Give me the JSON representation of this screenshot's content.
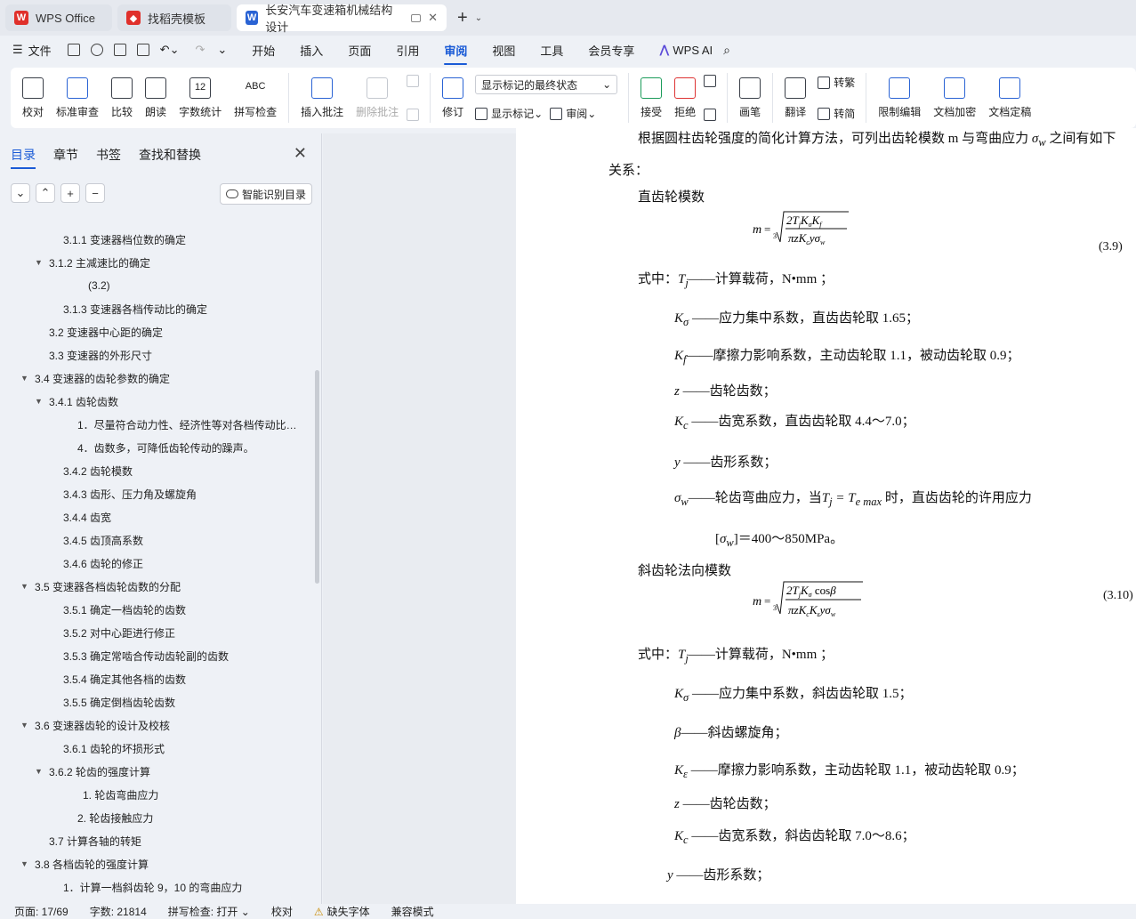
{
  "tabs": [
    {
      "label": "WPS Office",
      "color": "#e0302b"
    },
    {
      "label": "找稻壳模板",
      "color": "#e0302b"
    },
    {
      "label": "长安汽车变速箱机械结构设计",
      "color": "#2a63d4"
    }
  ],
  "menu": {
    "file": "文件",
    "items": [
      "开始",
      "插入",
      "页面",
      "引用",
      "审阅",
      "视图",
      "工具",
      "会员专享"
    ],
    "active": "审阅",
    "ai": "WPS AI"
  },
  "ribbon": {
    "proofread": "校对",
    "standard_review": "标准审查",
    "compare": "比较",
    "read_aloud": "朗读",
    "word_count": "字数统计",
    "spell_check": "拼写检查",
    "insert_comment": "插入批注",
    "delete_comment": "删除批注",
    "revise": "修订",
    "display_state": "显示标记的最终状态",
    "show_markup": "显示标记",
    "review": "审阅",
    "accept": "接受",
    "reject": "拒绝",
    "pen": "画笔",
    "translate": "翻译",
    "to_traditional": "转繁",
    "to_simplified": "转简",
    "restrict_edit": "限制编辑",
    "encrypt": "文档加密",
    "finalize": "文档定稿",
    "icon_word_count": "12",
    "icon_spell": "ABC"
  },
  "nav": {
    "tabs": [
      "目录",
      "章节",
      "书签",
      "查找和替换"
    ],
    "smart_toc": "智能识别目录",
    "items": [
      {
        "text": "3.1.1 变速器档位数的确定",
        "indent": 71,
        "caret": ""
      },
      {
        "text": "3.1.2 主减速比的确定",
        "indent": 55,
        "caret": "▼"
      },
      {
        "text": "(3.2)",
        "indent": 99,
        "caret": ""
      },
      {
        "text": "3.1.3  变速器各档传动比的确定",
        "indent": 71,
        "caret": ""
      },
      {
        "text": "3.2 变速器中心距的确定",
        "indent": 55,
        "caret": ""
      },
      {
        "text": "3.3 变速器的外形尺寸",
        "indent": 55,
        "caret": ""
      },
      {
        "text": "3.4 变速器的齿轮参数的确定",
        "indent": 39,
        "caret": "▼"
      },
      {
        "text": "3.4.1 齿轮齿数",
        "indent": 55,
        "caret": "▼"
      },
      {
        "text": "1．尽量符合动力性、经济性等对各档传动比…",
        "indent": 87,
        "caret": ""
      },
      {
        "text": "4．齿数多，可降低齿轮传动的躁声。",
        "indent": 87,
        "caret": ""
      },
      {
        "text": "3.4.2 齿轮模数",
        "indent": 71,
        "caret": ""
      },
      {
        "text": "3.4.3 齿形、压力角及螺旋角",
        "indent": 71,
        "caret": ""
      },
      {
        "text": "3.4.4 齿宽",
        "indent": 71,
        "caret": ""
      },
      {
        "text": "3.4.5 齿顶高系数",
        "indent": 71,
        "caret": ""
      },
      {
        "text": "3.4.6 齿轮的修正",
        "indent": 71,
        "caret": ""
      },
      {
        "text": "3.5 变速器各档齿轮齿数的分配",
        "indent": 39,
        "caret": "▼"
      },
      {
        "text": "3.5.1 确定一档齿轮的齿数",
        "indent": 71,
        "caret": ""
      },
      {
        "text": "3.5.2 对中心距进行修正",
        "indent": 71,
        "caret": ""
      },
      {
        "text": "3.5.3 确定常啮合传动齿轮副的齿数",
        "indent": 71,
        "caret": ""
      },
      {
        "text": "3.5.4 确定其他各档的齿数",
        "indent": 71,
        "caret": ""
      },
      {
        "text": "3.5.5 确定倒档齿轮齿数",
        "indent": 71,
        "caret": ""
      },
      {
        "text": "3.6 变速器齿轮的设计及校核",
        "indent": 39,
        "caret": "▼"
      },
      {
        "text": "3.6.1  齿轮的坏损形式",
        "indent": 71,
        "caret": ""
      },
      {
        "text": "3.6.2 轮齿的强度计算",
        "indent": 55,
        "caret": "▼"
      },
      {
        "text": "1. 轮齿弯曲应力",
        "indent": 93,
        "caret": ""
      },
      {
        "text": "2. 轮齿接触应力",
        "indent": 87,
        "caret": ""
      },
      {
        "text": "3.7 计算各轴的转矩",
        "indent": 55,
        "caret": ""
      },
      {
        "text": "3.8 各档齿轮的强度计算",
        "indent": 39,
        "caret": "▼"
      },
      {
        "text": "1．计算一档斜齿轮 9，10 的弯曲应力",
        "indent": 71,
        "caret": ""
      }
    ]
  },
  "doc": {
    "l1": "根据圆柱齿轮强度的简化计算方法，可列出齿轮模数 m 与弯曲应力",
    "l1_tail": "之间有如下",
    "l2": "关系：",
    "spur_title": "直齿轮模数",
    "eq1_no": "(3.9)",
    "where": "式中：",
    "load": "——计算载荷，N•mm ；",
    "k_sigma": "——应力集中系数，直齿齿轮取 1.65；",
    "k_f": "——摩擦力影响系数，主动齿轮取 1.1，被动齿轮取 0.9；",
    "z": "——齿轮齿数；",
    "k_c": "——齿宽系数，直齿齿轮取 4.4～7.0；",
    "y": "——齿形系数；",
    "sigma_w": "——轮齿弯曲应力，当",
    "sigma_w_tail": "时，直齿齿轮的许用应力",
    "allow": "]＝400～850MPa。",
    "helical_title": "斜齿轮法向模数",
    "eq2_no": "(3.10)",
    "k_sigma2": "——应力集中系数，斜齿齿轮取 1.5；",
    "beta": "——斜齿螺旋角；",
    "k_e": "——摩擦力影响系数，主动齿轮取 1.1，被动齿轮取 0.9；",
    "k_c2": "——齿宽系数，斜齿齿轮取 7.0～8.6；",
    "y2": " ——齿形系数；"
  },
  "status": {
    "page": "页面: 17/69",
    "words": "字数: 21814",
    "spell": "拼写检查: 打开",
    "proof": "校对",
    "missing_font": "缺失字体",
    "compat": "兼容模式"
  }
}
